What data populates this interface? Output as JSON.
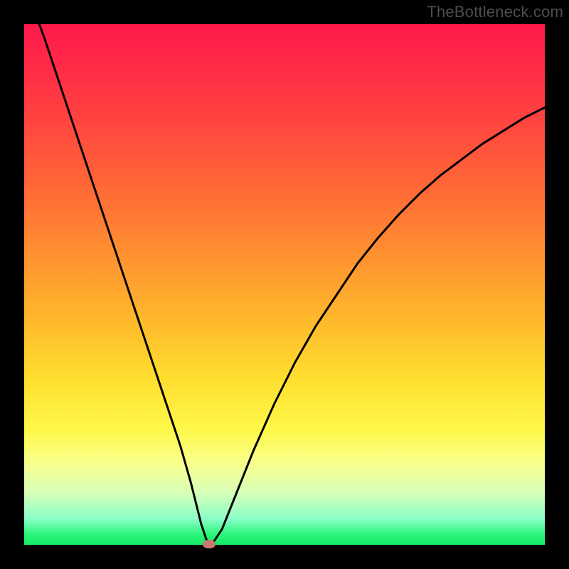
{
  "watermark": "TheBottleneck.com",
  "chart_data": {
    "type": "line",
    "title": "",
    "xlabel": "",
    "ylabel": "",
    "xlim": [
      0,
      100
    ],
    "ylim": [
      0,
      100
    ],
    "series": [
      {
        "name": "bottleneck-curve",
        "x": [
          0,
          4,
          8,
          12,
          16,
          20,
          24,
          28,
          30,
          32,
          33,
          34,
          35,
          36,
          38,
          40,
          44,
          48,
          52,
          56,
          60,
          64,
          68,
          72,
          76,
          80,
          84,
          88,
          92,
          96,
          100
        ],
        "values": [
          108,
          97,
          85,
          73,
          61,
          49,
          37,
          25,
          19,
          12,
          8,
          4,
          1,
          0,
          3,
          8,
          18,
          27,
          35,
          42,
          48,
          54,
          59,
          63.5,
          67.5,
          71,
          74,
          77,
          79.5,
          82,
          84
        ]
      }
    ],
    "marker": {
      "x": 35.5,
      "y": 0.2
    },
    "background_gradient": {
      "top_color": "#ff1a4c",
      "bottom_color": "#13e968"
    }
  }
}
